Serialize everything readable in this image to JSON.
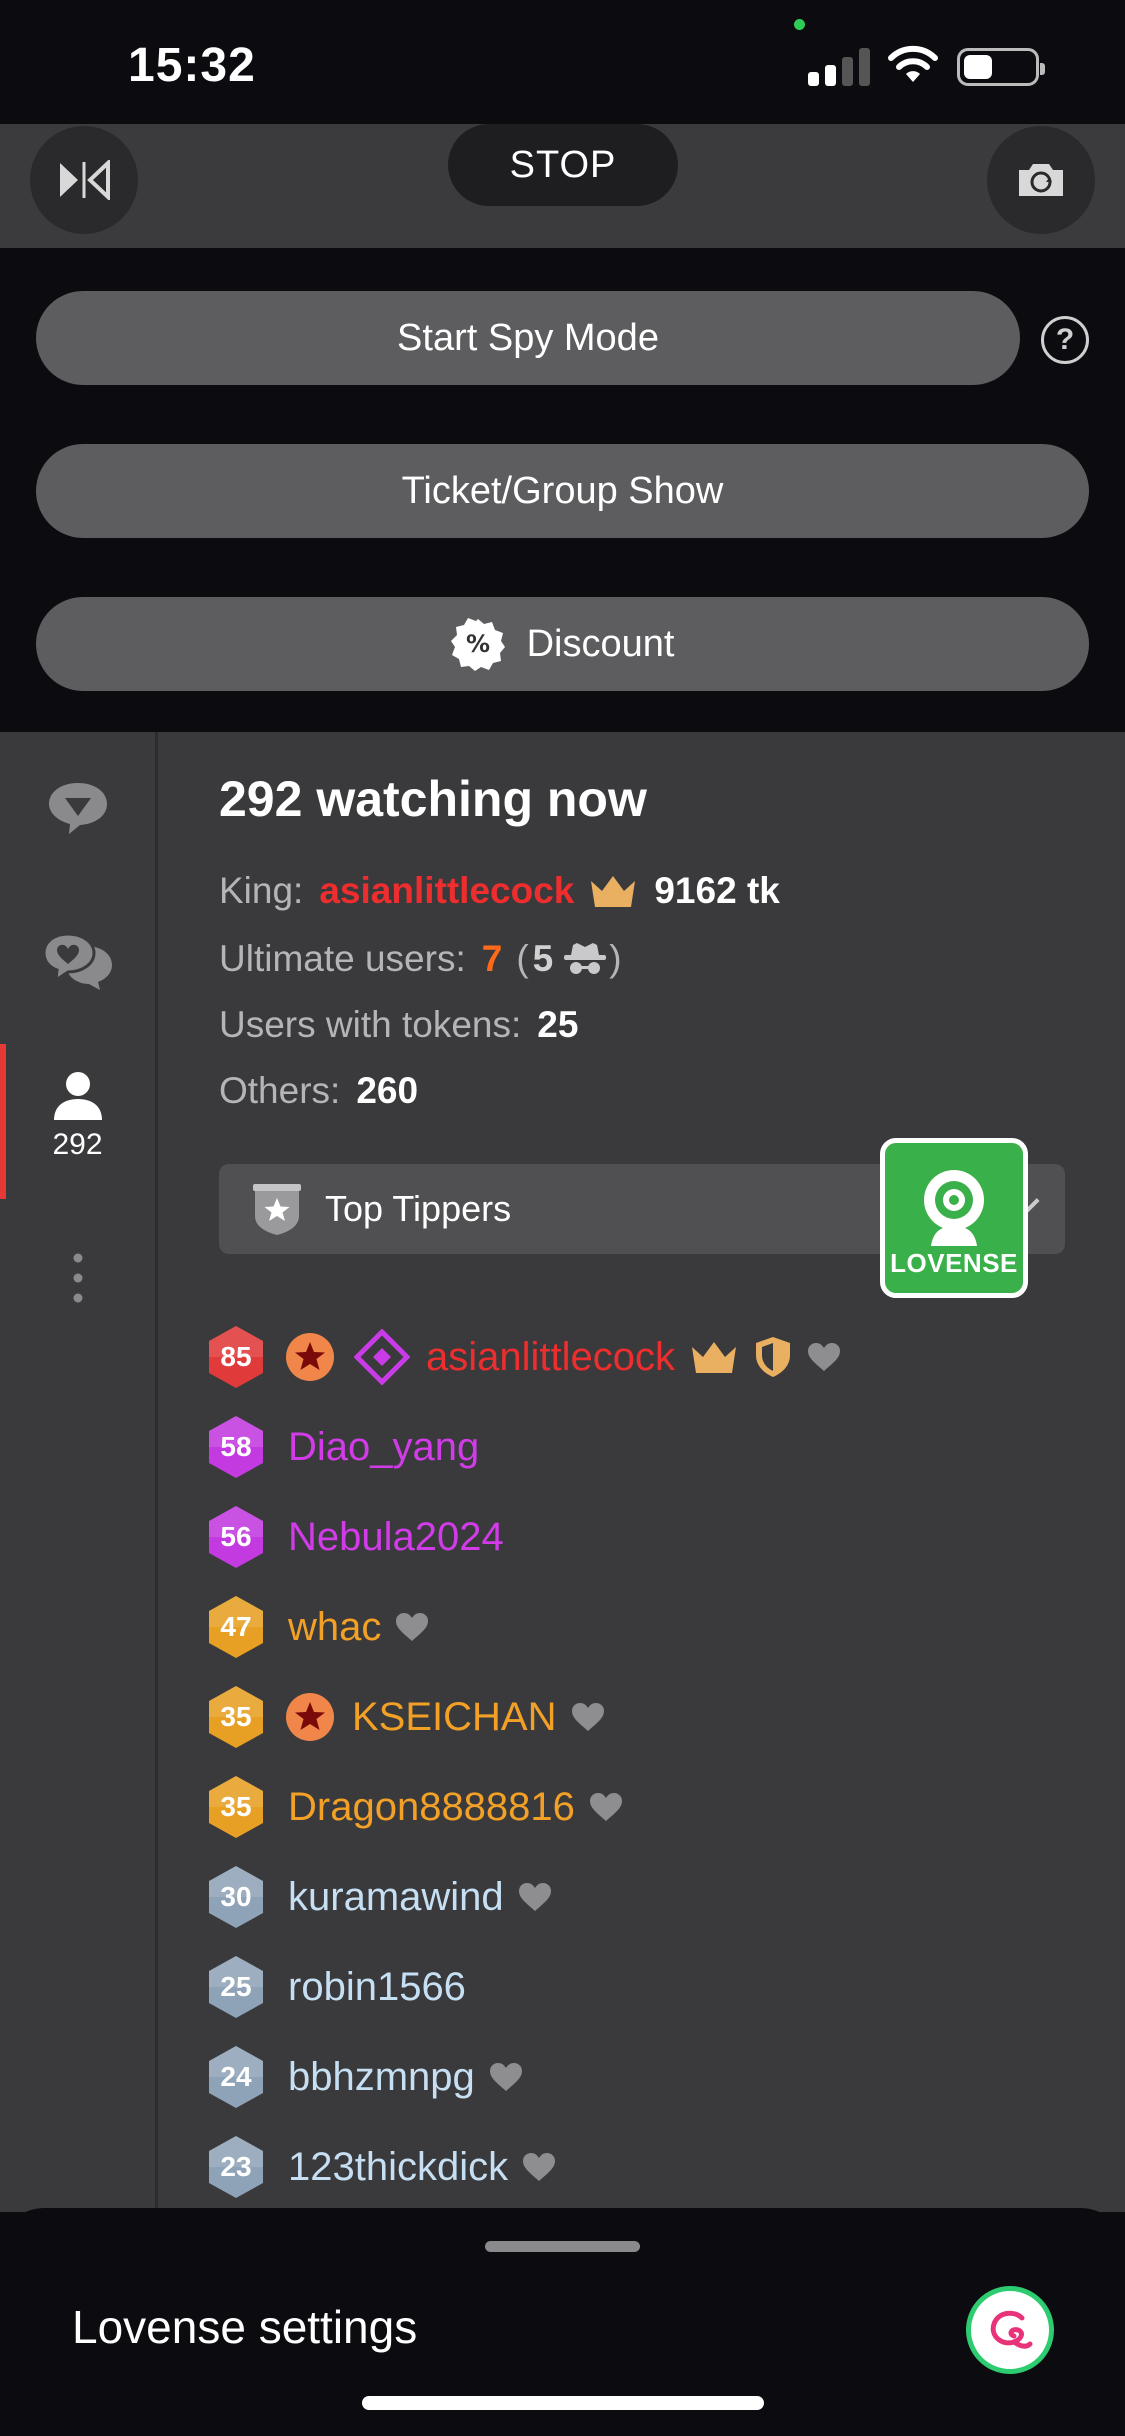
{
  "status_bar": {
    "time": "15:32"
  },
  "video": {
    "stop_label": "STOP"
  },
  "actions": {
    "spy_mode_label": "Start Spy Mode",
    "help_label": "?",
    "ticket_show_label": "Ticket/Group Show",
    "discount_label": "Discount"
  },
  "sidebar": {
    "items": [
      {
        "icon": "tip-chat-icon"
      },
      {
        "icon": "private-chat-icon"
      },
      {
        "icon": "user-icon",
        "count": "292",
        "active": true
      },
      {
        "icon": "more-icon"
      }
    ]
  },
  "users_panel": {
    "watching_text": "292 watching now",
    "king_label": "King:",
    "king_name": "asianlittlecock",
    "king_tokens": "9162 tk",
    "ultimate_label": "Ultimate users:",
    "ultimate_count": "7",
    "ultimate_paren_open": "(",
    "ultimate_hidden_count": "5",
    "ultimate_paren_close": ")",
    "with_tokens_label": "Users with tokens:",
    "with_tokens_count": "25",
    "others_label": "Others:",
    "others_count": "260",
    "top_tippers_label": "Top Tippers",
    "lovense_label": "LOVENSE"
  },
  "users": [
    {
      "level": "85",
      "name": "asianlittlecock",
      "name_color": "#ee2e2e",
      "badge_color": "#e03a3a"
    },
    {
      "level": "58",
      "name": "Diao_yang",
      "name_color": "#d23be8",
      "badge_color": "#c33be0"
    },
    {
      "level": "56",
      "name": "Nebula2024",
      "name_color": "#d23be8",
      "badge_color": "#c33be0"
    },
    {
      "level": "47",
      "name": "whac",
      "name_color": "#f2a126",
      "badge_color": "#e7a024"
    },
    {
      "level": "35",
      "name": "KSEICHAN",
      "name_color": "#f2a126",
      "badge_color": "#e7a024"
    },
    {
      "level": "35",
      "name": "Dragon8888816",
      "name_color": "#f2a126",
      "badge_color": "#e7a024"
    },
    {
      "level": "30",
      "name": "kuramawind",
      "name_color": "#c6dff3",
      "badge_color": "#8fa3b8"
    },
    {
      "level": "25",
      "name": "robin1566",
      "name_color": "#c6dff3",
      "badge_color": "#8fa3b8"
    },
    {
      "level": "24",
      "name": "bbhzmnpg",
      "name_color": "#c6dff3",
      "badge_color": "#8fa3b8"
    },
    {
      "level": "23",
      "name": "123thickdick",
      "name_color": "#c6dff3",
      "badge_color": "#8fa3b8"
    }
  ],
  "sheet": {
    "title": "Lovense settings"
  }
}
